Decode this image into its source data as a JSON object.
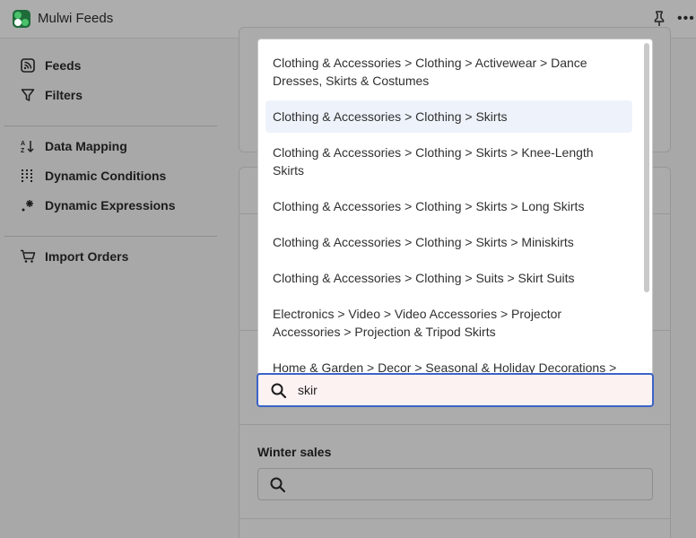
{
  "app": {
    "title": "Mulwi Feeds"
  },
  "sidebar": {
    "items": [
      {
        "label": "Feeds",
        "icon": "rss-icon"
      },
      {
        "label": "Filters",
        "icon": "filter-icon"
      },
      {
        "label": "Data Mapping",
        "icon": "sort-icon"
      },
      {
        "label": "Dynamic Conditions",
        "icon": "dotted-grid-icon"
      },
      {
        "label": "Dynamic Expressions",
        "icon": "sparkle-icon"
      },
      {
        "label": "Import Orders",
        "icon": "cart-icon"
      }
    ]
  },
  "dropdown": {
    "options": [
      "Clothing & Accessories > Clothing > Activewear > Dance Dresses, Skirts & Costumes",
      "Clothing & Accessories > Clothing > Skirts",
      "Clothing & Accessories > Clothing > Skirts > Knee-Length Skirts",
      "Clothing & Accessories > Clothing > Skirts > Long Skirts",
      "Clothing & Accessories > Clothing > Skirts > Miniskirts",
      "Clothing & Accessories > Clothing > Suits > Skirt Suits",
      "Electronics > Video > Video Accessories > Projector Accessories > Projection & Tripod Skirts",
      "Home & Garden > Decor > Seasonal & Holiday Decorations >"
    ],
    "active_index": 1
  },
  "search": {
    "value": "skir"
  },
  "section": {
    "winter_label": "Winter sales"
  },
  "colors": {
    "accent": "#3c63c6",
    "overlay": "#a8a8a8",
    "highlight": "#eef3fb"
  }
}
